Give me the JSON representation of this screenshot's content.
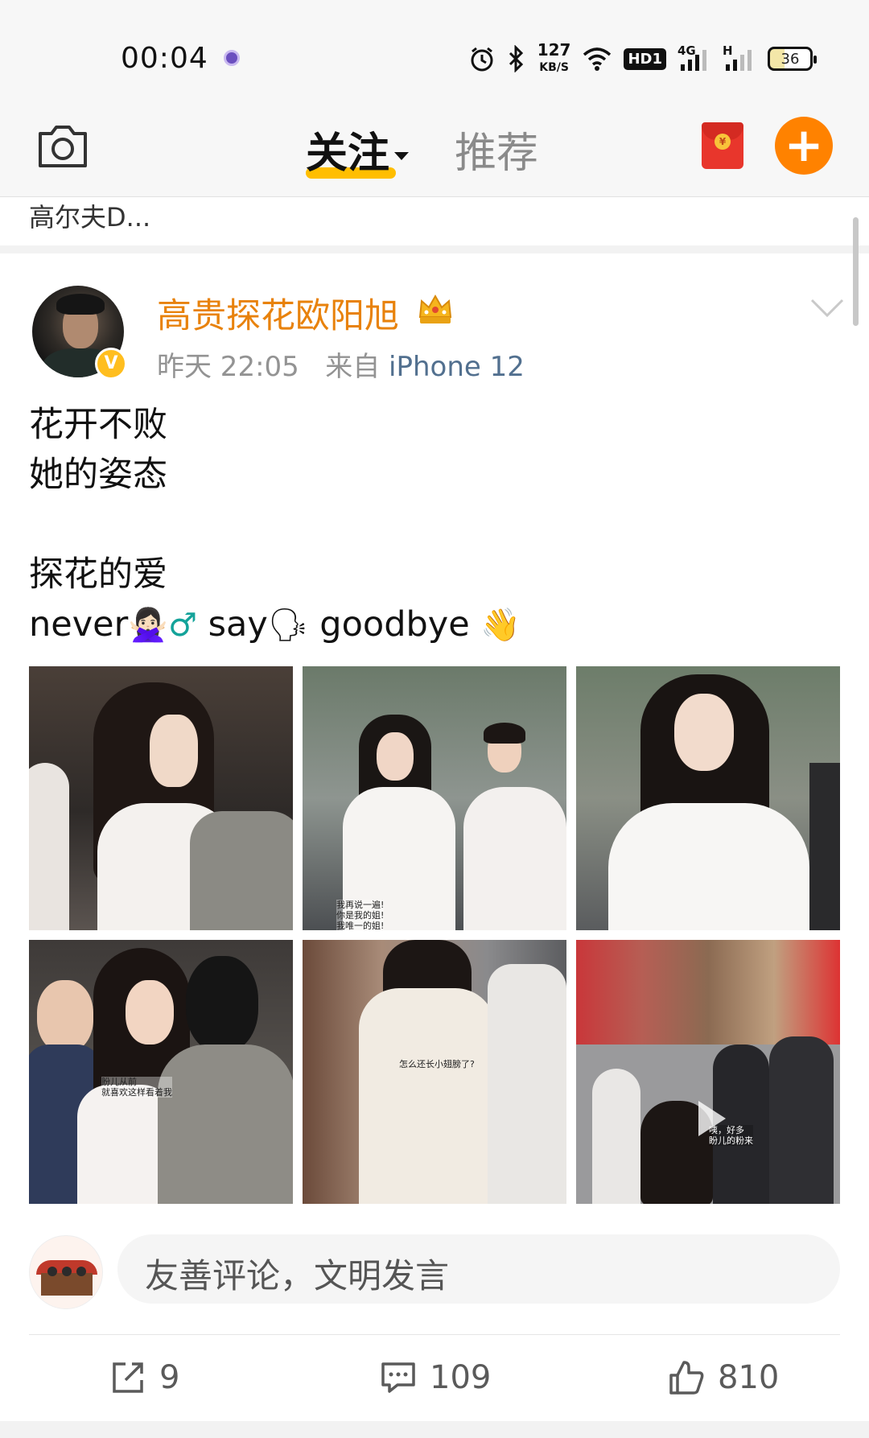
{
  "status_bar": {
    "time": "00:04",
    "speed_value": "127",
    "speed_unit": "KB/S",
    "hd_label": "HD1",
    "net_4g": "4G",
    "net_h": "H",
    "battery": "36",
    "icons": [
      "alarm-icon",
      "bluetooth-icon",
      "wifi-icon",
      "signal-icon"
    ]
  },
  "header": {
    "tabs": [
      {
        "label": "关注",
        "active": true
      },
      {
        "label": "推荐",
        "active": false
      }
    ],
    "accent_color": "#ffbe00",
    "add_button": "+"
  },
  "prev_card": {
    "text": "高尔夫D..."
  },
  "post": {
    "username": "高贵探花欧阳旭",
    "username_color": "#e8820c",
    "time": "昨天 22:05",
    "source_prefix": "来自",
    "source": "iPhone 12",
    "lines": [
      "花开不败",
      "她的姿态",
      "",
      "探花的爱"
    ],
    "last_line": {
      "w1": "never",
      "e1": "🙅🏻‍♀️",
      "e2": "♂",
      "w2": " say",
      "e3": "🗣",
      "w3": " goodbye ",
      "e4": "👋"
    },
    "image_captions": [
      "我再说一遍!\n你是我的姐!\n我唯一的姐!",
      "盼儿从前\n就喜欢这样看着我",
      "怎么还长小翅膀了?",
      "咦，好多\n盼儿的粉来"
    ]
  },
  "comment_box": {
    "placeholder": "友善评论，文明发言"
  },
  "actions": {
    "reposts": "9",
    "comments": "109",
    "likes": "810"
  }
}
